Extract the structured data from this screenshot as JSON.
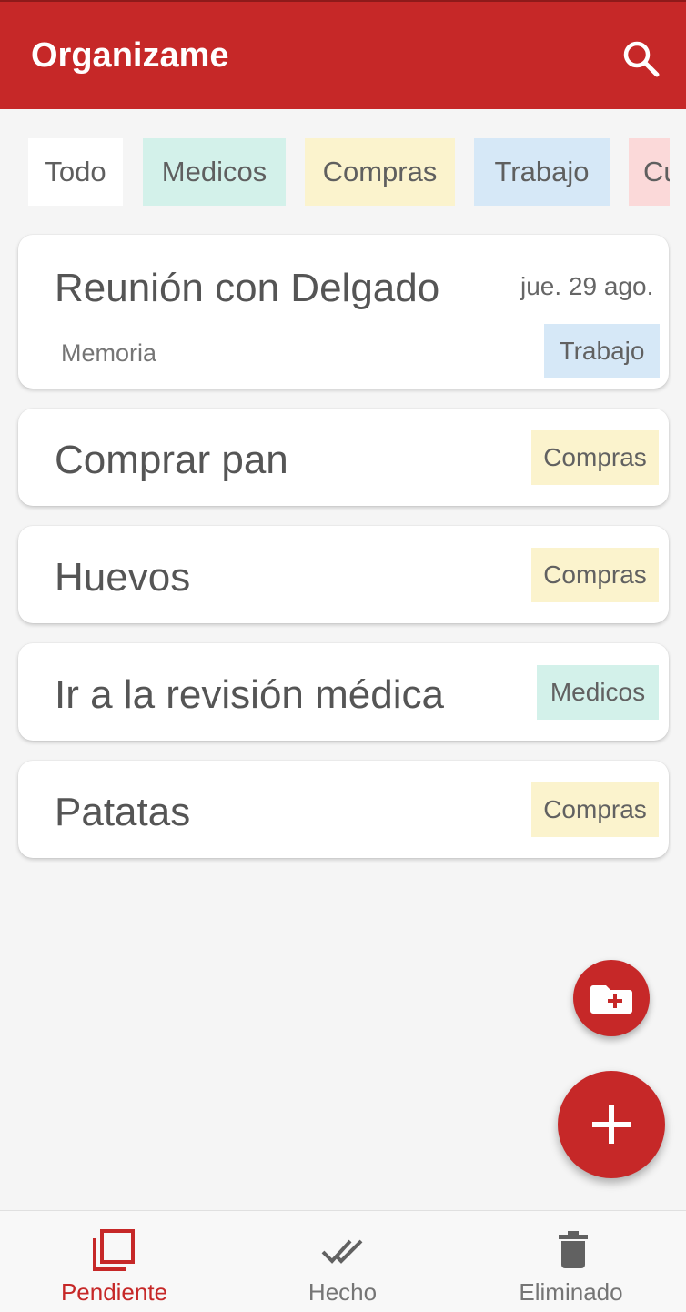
{
  "app": {
    "title": "Organizame"
  },
  "filters": [
    {
      "label": "Todo",
      "color": "#ffffff"
    },
    {
      "label": "Medicos",
      "color": "#d3f1ea"
    },
    {
      "label": "Compras",
      "color": "#fbf3cd"
    },
    {
      "label": "Trabajo",
      "color": "#d6e8f7"
    },
    {
      "label": "Cu",
      "color": "#fbd9d9"
    }
  ],
  "tasks": [
    {
      "title": "Reunión con Delgado",
      "date": "jue. 29 ago.",
      "note": "Memoria",
      "tag": "Trabajo",
      "tag_color": "#d6e8f7"
    },
    {
      "title": "Comprar pan",
      "tag": "Compras",
      "tag_color": "#fbf3cd"
    },
    {
      "title": "Huevos",
      "tag": "Compras",
      "tag_color": "#fbf3cd"
    },
    {
      "title": "Ir a la revisión médica",
      "tag": "Medicos",
      "tag_color": "#d3f1ea"
    },
    {
      "title": "Patatas",
      "tag": "Compras",
      "tag_color": "#fbf3cd"
    }
  ],
  "icons": {
    "search": "search-icon",
    "add_category": "folder-plus-icon",
    "add_task": "plus-icon",
    "pending": "pending-stack-icon",
    "done": "double-check-icon",
    "deleted": "trash-icon"
  },
  "bottom_nav": [
    {
      "label": "Pendiente",
      "active": true
    },
    {
      "label": "Hecho",
      "active": false
    },
    {
      "label": "Eliminado",
      "active": false
    }
  ],
  "colors": {
    "primary": "#c62828",
    "background": "#f5f5f5"
  }
}
